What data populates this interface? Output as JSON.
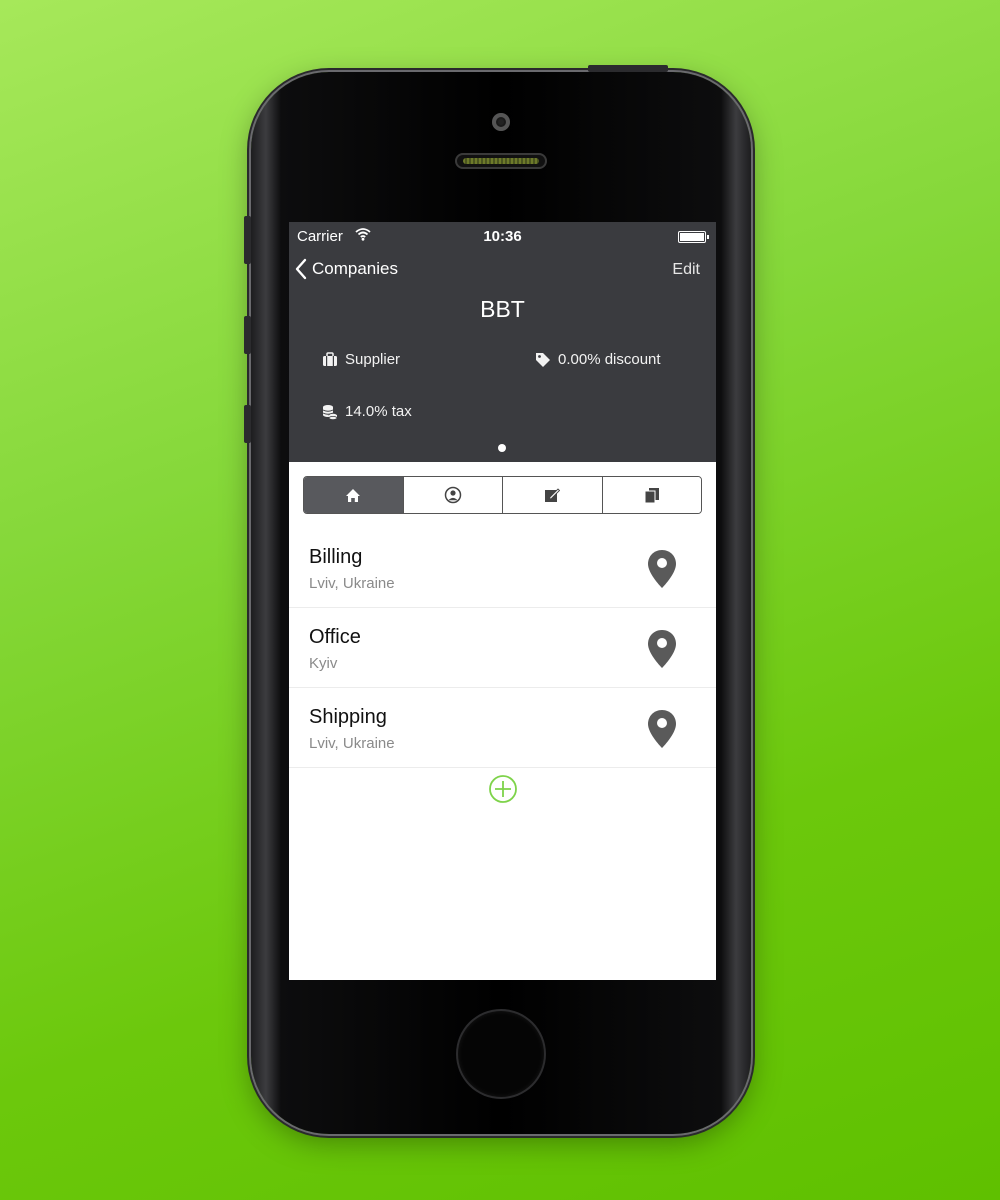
{
  "colors": {
    "header_bg": "#3a3b3f",
    "accent_green": "#7ed34a",
    "pin_gray": "#5a5a5a"
  },
  "status_bar": {
    "carrier": "Carrier",
    "time": "10:36"
  },
  "nav": {
    "back_label": "Companies",
    "edit_label": "Edit",
    "title": "BBT"
  },
  "info": {
    "type": "Supplier",
    "discount": "0.00% discount",
    "tax": "14.0% tax"
  },
  "page_indicator": {
    "pages": 1,
    "current": 1
  },
  "segments": [
    {
      "icon": "home-icon",
      "active": true
    },
    {
      "icon": "person-icon",
      "active": false
    },
    {
      "icon": "note-edit-icon",
      "active": false
    },
    {
      "icon": "documents-icon",
      "active": false
    }
  ],
  "addresses": [
    {
      "name": "Billing",
      "location": "Lviv, Ukraine",
      "icon": "map-pin-icon"
    },
    {
      "name": "Office",
      "location": "Kyiv",
      "icon": "map-pin-icon"
    },
    {
      "name": "Shipping",
      "location": "Lviv, Ukraine",
      "icon": "map-pin-icon"
    }
  ],
  "add_button": {
    "icon": "plus-circle-icon"
  }
}
